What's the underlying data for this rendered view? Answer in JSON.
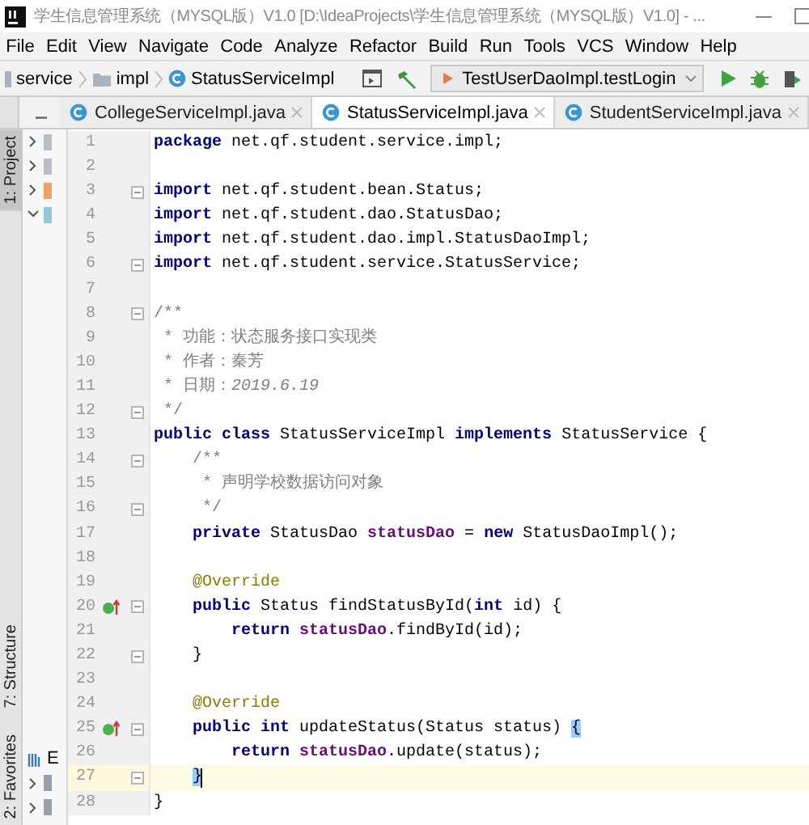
{
  "window": {
    "title": "学生信息管理系统（MYSQL版）V1.0 [D:\\IdeaProjects\\学生信息管理系统（MYSQL版）V1.0] - ..."
  },
  "menu": [
    "File",
    "Edit",
    "View",
    "Navigate",
    "Code",
    "Analyze",
    "Refactor",
    "Build",
    "Run",
    "Tools",
    "VCS",
    "Window",
    "Help"
  ],
  "navbar": {
    "breadcrumbs": [
      "service",
      "impl",
      "StatusServiceImpl"
    ],
    "run_config": "TestUserDaoImpl.testLogin"
  },
  "tabs": [
    {
      "label": "CollegeServiceImpl.java",
      "selected": false
    },
    {
      "label": "StatusServiceImpl.java",
      "selected": true
    },
    {
      "label": "StudentServiceImpl.java",
      "selected": false
    }
  ],
  "tool_strip": [
    {
      "label": "1: Project",
      "selected": true
    },
    {
      "label": "7: Structure",
      "selected": false
    },
    {
      "label": "2: Favorites",
      "selected": false
    }
  ],
  "project_panel": {
    "fragment": "E"
  },
  "editor": {
    "lines": [
      {
        "number": "1",
        "current": false,
        "fold": false,
        "marker": false,
        "segments": [
          {
            "kind": "keyword",
            "text": "package"
          },
          {
            "kind": "plain",
            "text": " net.qf.student.service.impl;"
          }
        ]
      },
      {
        "number": "2",
        "current": false,
        "fold": false,
        "marker": false
      },
      {
        "number": "3",
        "current": false,
        "fold": true,
        "marker": false,
        "segments": [
          {
            "kind": "keyword",
            "text": "import"
          },
          {
            "kind": "plain",
            "text": " net.qf.student.bean.Status;"
          }
        ]
      },
      {
        "number": "4",
        "current": false,
        "fold": false,
        "marker": false,
        "segments": [
          {
            "kind": "keyword",
            "text": "import"
          },
          {
            "kind": "plain",
            "text": " net.qf.student.dao.StatusDao;"
          }
        ]
      },
      {
        "number": "5",
        "current": false,
        "fold": false,
        "marker": false,
        "segments": [
          {
            "kind": "keyword",
            "text": "import"
          },
          {
            "kind": "plain",
            "text": " net.qf.student.dao.impl.StatusDaoImpl;"
          }
        ]
      },
      {
        "number": "6",
        "current": false,
        "fold": true,
        "marker": false,
        "segments": [
          {
            "kind": "keyword",
            "text": "import"
          },
          {
            "kind": "plain",
            "text": " net.qf.student.service.StatusService;"
          }
        ]
      },
      {
        "number": "7",
        "current": false,
        "fold": false,
        "marker": false
      },
      {
        "number": "8",
        "current": false,
        "fold": true,
        "marker": false,
        "segments": [
          {
            "kind": "comment",
            "text": "/**"
          }
        ]
      },
      {
        "number": "9",
        "current": false,
        "fold": false,
        "marker": false,
        "segments": [
          {
            "kind": "comment",
            "text": " * 功能：状态服务接口实现类"
          }
        ]
      },
      {
        "number": "10",
        "current": false,
        "fold": false,
        "marker": false,
        "segments": [
          {
            "kind": "comment",
            "text": " * 作者：秦芳"
          }
        ]
      },
      {
        "number": "11",
        "current": false,
        "fold": false,
        "marker": false,
        "segments": [
          {
            "kind": "comment",
            "text": " * 日期："
          },
          {
            "kind": "comment-italic",
            "text": "2019.6.19"
          }
        ]
      },
      {
        "number": "12",
        "current": false,
        "fold": true,
        "marker": false,
        "segments": [
          {
            "kind": "comment",
            "text": " */"
          }
        ]
      },
      {
        "number": "13",
        "current": false,
        "fold": false,
        "marker": false,
        "segments": [
          {
            "kind": "keyword",
            "text": "public class"
          },
          {
            "kind": "plain",
            "text": " StatusServiceImpl "
          },
          {
            "kind": "keyword",
            "text": "implements"
          },
          {
            "kind": "plain",
            "text": " StatusService {"
          }
        ]
      },
      {
        "number": "14",
        "current": false,
        "fold": true,
        "marker": false,
        "segments": [
          {
            "kind": "comment",
            "text": "    /**"
          }
        ]
      },
      {
        "number": "15",
        "current": false,
        "fold": false,
        "marker": false,
        "segments": [
          {
            "kind": "comment",
            "text": "     * 声明学校数据访问对象"
          }
        ]
      },
      {
        "number": "16",
        "current": false,
        "fold": true,
        "marker": false,
        "segments": [
          {
            "kind": "comment",
            "text": "     */"
          }
        ]
      },
      {
        "number": "17",
        "current": false,
        "fold": false,
        "marker": false,
        "segments": [
          {
            "kind": "keyword",
            "text": "    private"
          },
          {
            "kind": "plain",
            "text": " StatusDao "
          },
          {
            "kind": "field",
            "text": "statusDao"
          },
          {
            "kind": "plain",
            "text": " = "
          },
          {
            "kind": "keyword",
            "text": "new"
          },
          {
            "kind": "plain",
            "text": " StatusDaoImpl();"
          }
        ]
      },
      {
        "number": "18",
        "current": false,
        "fold": false,
        "marker": false
      },
      {
        "number": "19",
        "current": false,
        "fold": false,
        "marker": false,
        "segments": [
          {
            "kind": "annotation",
            "text": "    @Override"
          }
        ]
      },
      {
        "number": "20",
        "current": false,
        "fold": true,
        "marker": true,
        "segments": [
          {
            "kind": "keyword",
            "text": "    public"
          },
          {
            "kind": "plain",
            "text": " Status findStatusById("
          },
          {
            "kind": "keyword",
            "text": "int"
          },
          {
            "kind": "plain",
            "text": " id) {"
          }
        ]
      },
      {
        "number": "21",
        "current": false,
        "fold": false,
        "marker": false,
        "segments": [
          {
            "kind": "keyword",
            "text": "        return"
          },
          {
            "kind": "field",
            "text": " statusDao"
          },
          {
            "kind": "plain",
            "text": ".findById(id);"
          }
        ]
      },
      {
        "number": "22",
        "current": false,
        "fold": true,
        "marker": false,
        "segments": [
          {
            "kind": "plain",
            "text": "    }"
          }
        ]
      },
      {
        "number": "23",
        "current": false,
        "fold": false,
        "marker": false
      },
      {
        "number": "24",
        "current": false,
        "fold": false,
        "marker": false,
        "segments": [
          {
            "kind": "annotation",
            "text": "    @Override"
          }
        ]
      },
      {
        "number": "25",
        "current": false,
        "fold": true,
        "marker": true,
        "segments": [
          {
            "kind": "keyword",
            "text": "    public int"
          },
          {
            "kind": "plain",
            "text": " updateStatus(Status status) "
          },
          {
            "kind": "brace-match",
            "text": "{"
          }
        ]
      },
      {
        "number": "26",
        "current": false,
        "fold": false,
        "marker": false,
        "segments": [
          {
            "kind": "keyword",
            "text": "        return"
          },
          {
            "kind": "field",
            "text": " statusDao"
          },
          {
            "kind": "plain",
            "text": ".update(status);"
          }
        ]
      },
      {
        "number": "27",
        "current": true,
        "fold": true,
        "marker": false,
        "segments": [
          {
            "kind": "indent-brace-match",
            "text": "    }"
          }
        ]
      },
      {
        "number": "28",
        "current": false,
        "fold": false,
        "marker": false,
        "segments": [
          {
            "kind": "plain",
            "text": "}"
          }
        ]
      }
    ]
  }
}
